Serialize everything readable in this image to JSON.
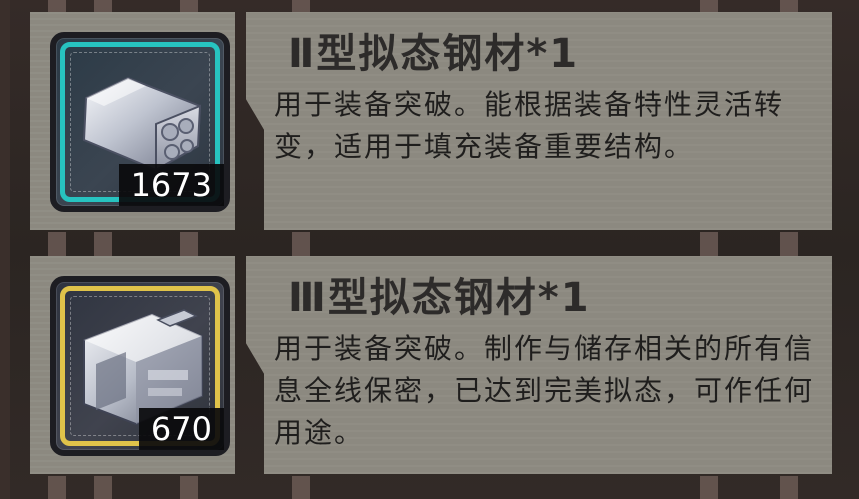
{
  "items": [
    {
      "name": "Ⅱ型拟态钢材*1",
      "description": "用于装备突破。能根据装备特性灵活转变，适用于填充装备重要结构。",
      "count": "1673",
      "ring_color": "#27c3c0",
      "icon": "steel-bar-icon"
    },
    {
      "name": "Ⅲ型拟态钢材*1",
      "description": "用于装备突破。制作与储存相关的所有信息全线保密，已达到完美拟态，可作任何用途。",
      "count": "670",
      "ring_color": "#e0c34a",
      "icon": "steel-block-icon"
    }
  ]
}
